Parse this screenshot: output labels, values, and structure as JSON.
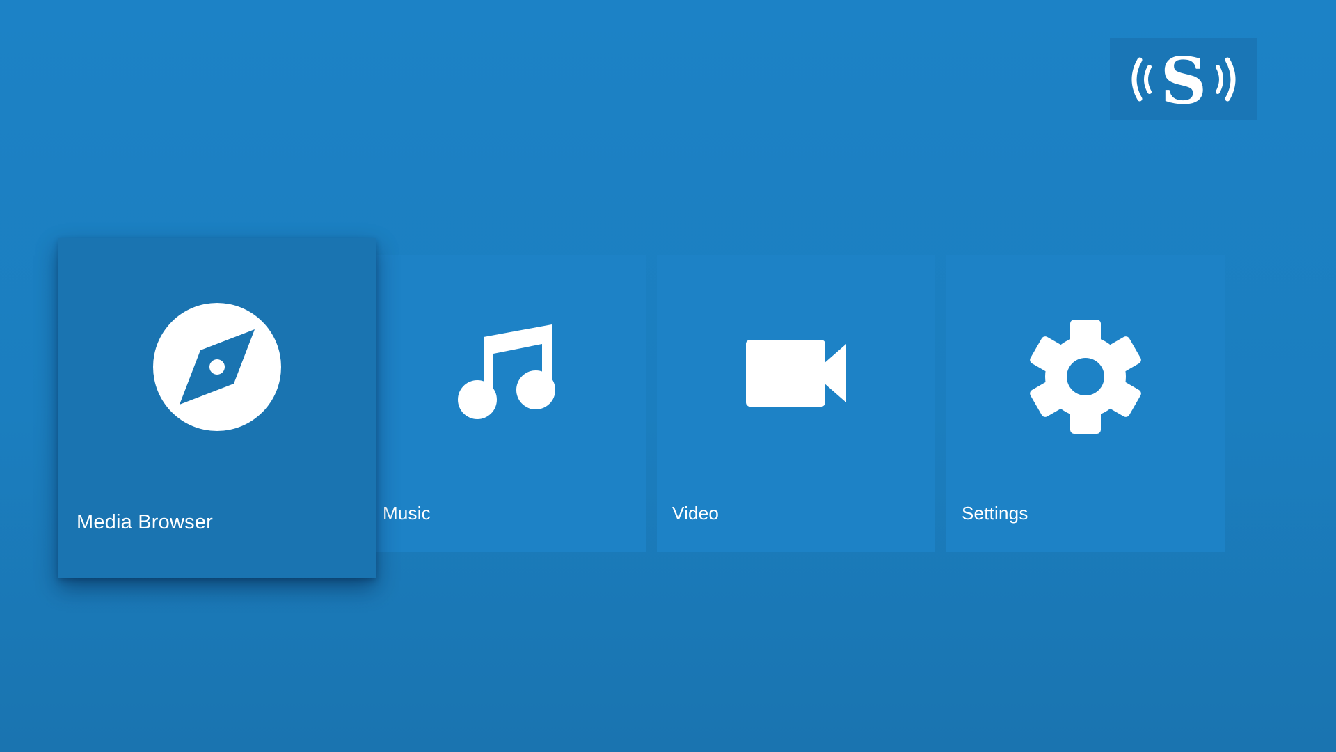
{
  "app": {
    "logo_letter": "S",
    "logo_icon": "broadcast-s-logo"
  },
  "tiles": [
    {
      "label": "Media Browser",
      "icon": "compass-icon",
      "focused": true
    },
    {
      "label": "Music",
      "icon": "music-note-icon",
      "focused": false
    },
    {
      "label": "Video",
      "icon": "videocam-icon",
      "focused": false
    },
    {
      "label": "Settings",
      "icon": "gear-icon",
      "focused": false
    }
  ],
  "colors": {
    "background": "#1c82c6",
    "tile": "#1d82c6",
    "tile_focused": "#1a74b1",
    "logo_bg": "#1a76b6",
    "foreground": "#ffffff"
  }
}
